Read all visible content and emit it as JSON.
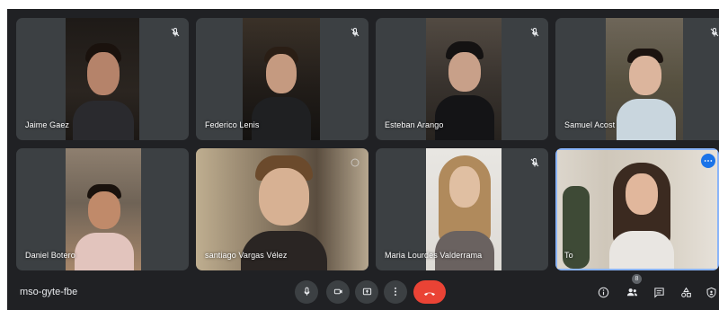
{
  "meeting_code": "mso-gyte-fbe",
  "participants": [
    {
      "name": "Jaime Gaez",
      "muted": true
    },
    {
      "name": "Federico Lenis",
      "muted": true
    },
    {
      "name": "Esteban Arango",
      "muted": true
    },
    {
      "name": "Samuel Acost",
      "muted": true
    },
    {
      "name": "Daniel Botero",
      "muted": false
    },
    {
      "name": "santiago Vargas Vélez",
      "muted": false
    },
    {
      "name": "Maria Lourdes Valderrama",
      "muted": true
    },
    {
      "name": "To",
      "muted": false
    }
  ],
  "participant_count": "8",
  "controls": [
    "mic-icon",
    "camera-icon",
    "present-icon",
    "more-options-icon",
    "end-call-icon"
  ],
  "right_icons": [
    "info-icon",
    "people-icon",
    "chat-icon",
    "activities-icon",
    "host-controls-icon"
  ],
  "colors": {
    "background": "#202124",
    "tile": "#3c4043",
    "end_call": "#ea4335",
    "active_border": "#8ab4f8"
  }
}
